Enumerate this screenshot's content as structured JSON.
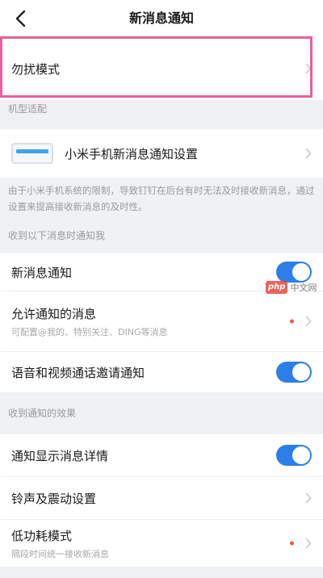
{
  "header": {
    "title": "新消息通知"
  },
  "dnd": {
    "label": "勿扰模式"
  },
  "section_device": {
    "label": "机型适配"
  },
  "device_row": {
    "label": "小米手机新消息通知设置"
  },
  "device_note": {
    "text": "由于小米手机系统的限制，导致钉钉在后台有时无法及时接收新消息，通过设置来提高接收新消息的及时性。"
  },
  "section_receive": {
    "label": "收到以下消息时通知我"
  },
  "receive_items": {
    "new_msg": {
      "label": "新消息通知",
      "on": true
    },
    "allowed": {
      "label": "允许通知的消息",
      "sub": "可配置@我的、特别关注、DING等消息"
    },
    "av_invite": {
      "label": "语音和视频通话邀请通知",
      "on": true
    }
  },
  "section_effect": {
    "label": "收到通知的效果"
  },
  "effect_items": {
    "detail": {
      "label": "通知显示消息详情",
      "on": true
    },
    "ring": {
      "label": "铃声及震动设置"
    },
    "lowpower": {
      "label": "低功耗模式",
      "sub": "隔段时间统一接收新消息"
    }
  },
  "watermark": {
    "badge": "php",
    "text": "中文网"
  },
  "colors": {
    "toggle_on": "#2d7ee8",
    "highlight": "#e7609a",
    "dot": "#f3553b"
  }
}
